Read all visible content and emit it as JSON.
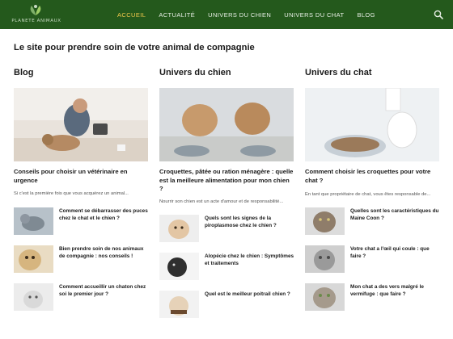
{
  "header": {
    "logo_text": "PLANETE ANIMAUX",
    "nav": [
      {
        "label": "ACCUEIL"
      },
      {
        "label": "ACTUALITÉ"
      },
      {
        "label": "UNIVERS DU CHIEN"
      },
      {
        "label": "UNIVERS DU CHAT"
      },
      {
        "label": "BLOG"
      }
    ],
    "active_item": "ACCUEIL",
    "search_icon": "search-icon"
  },
  "tagline": "Le site pour prendre soin de votre animal de compagnie",
  "columns": [
    {
      "title": "Blog",
      "hero": {
        "title": "Conseils pour choisir un vétérinaire en urgence",
        "excerpt": "Si c'est la première fois que vous acquérez un animal..."
      },
      "items": [
        {
          "title": "Comment se débarrasser des puces chez le chat et le chien ?"
        },
        {
          "title": "Bien prendre soin de nos animaux de compagnie : nos conseils !"
        },
        {
          "title": "Comment accueillir un chaton chez soi le premier jour ?"
        }
      ]
    },
    {
      "title": "Univers du chien",
      "hero": {
        "title": "Croquettes, pâtée ou ration ménagère : quelle est la meilleure alimentation pour mon chien ?",
        "excerpt": "Nourrir son chien est un acte d'amour et de responsabilité..."
      },
      "items": [
        {
          "title": "Quels sont les signes de la piroplasmose chez le chien ?"
        },
        {
          "title": "Alopécie chez le chien : Symptômes et traitements"
        },
        {
          "title": "Quel est le meilleur poitrail chien ?"
        }
      ]
    },
    {
      "title": "Univers du chat",
      "hero": {
        "title": "Comment choisir les croquettes pour votre chat ?",
        "excerpt": "En tant que propriétaire de chat, vous êtes responsable de..."
      },
      "items": [
        {
          "title": "Quelles sont les caractéristiques du Maine Coon ?"
        },
        {
          "title": "Votre chat a l'œil qui coule : que faire ?"
        },
        {
          "title": "Mon chat a des vers malgré le vermifuge : que faire ?"
        }
      ]
    }
  ],
  "colors": {
    "header_bg": "#24591c",
    "nav_text": "#e8efe6",
    "nav_active": "#f2c94c",
    "text": "#1a1a1a"
  }
}
